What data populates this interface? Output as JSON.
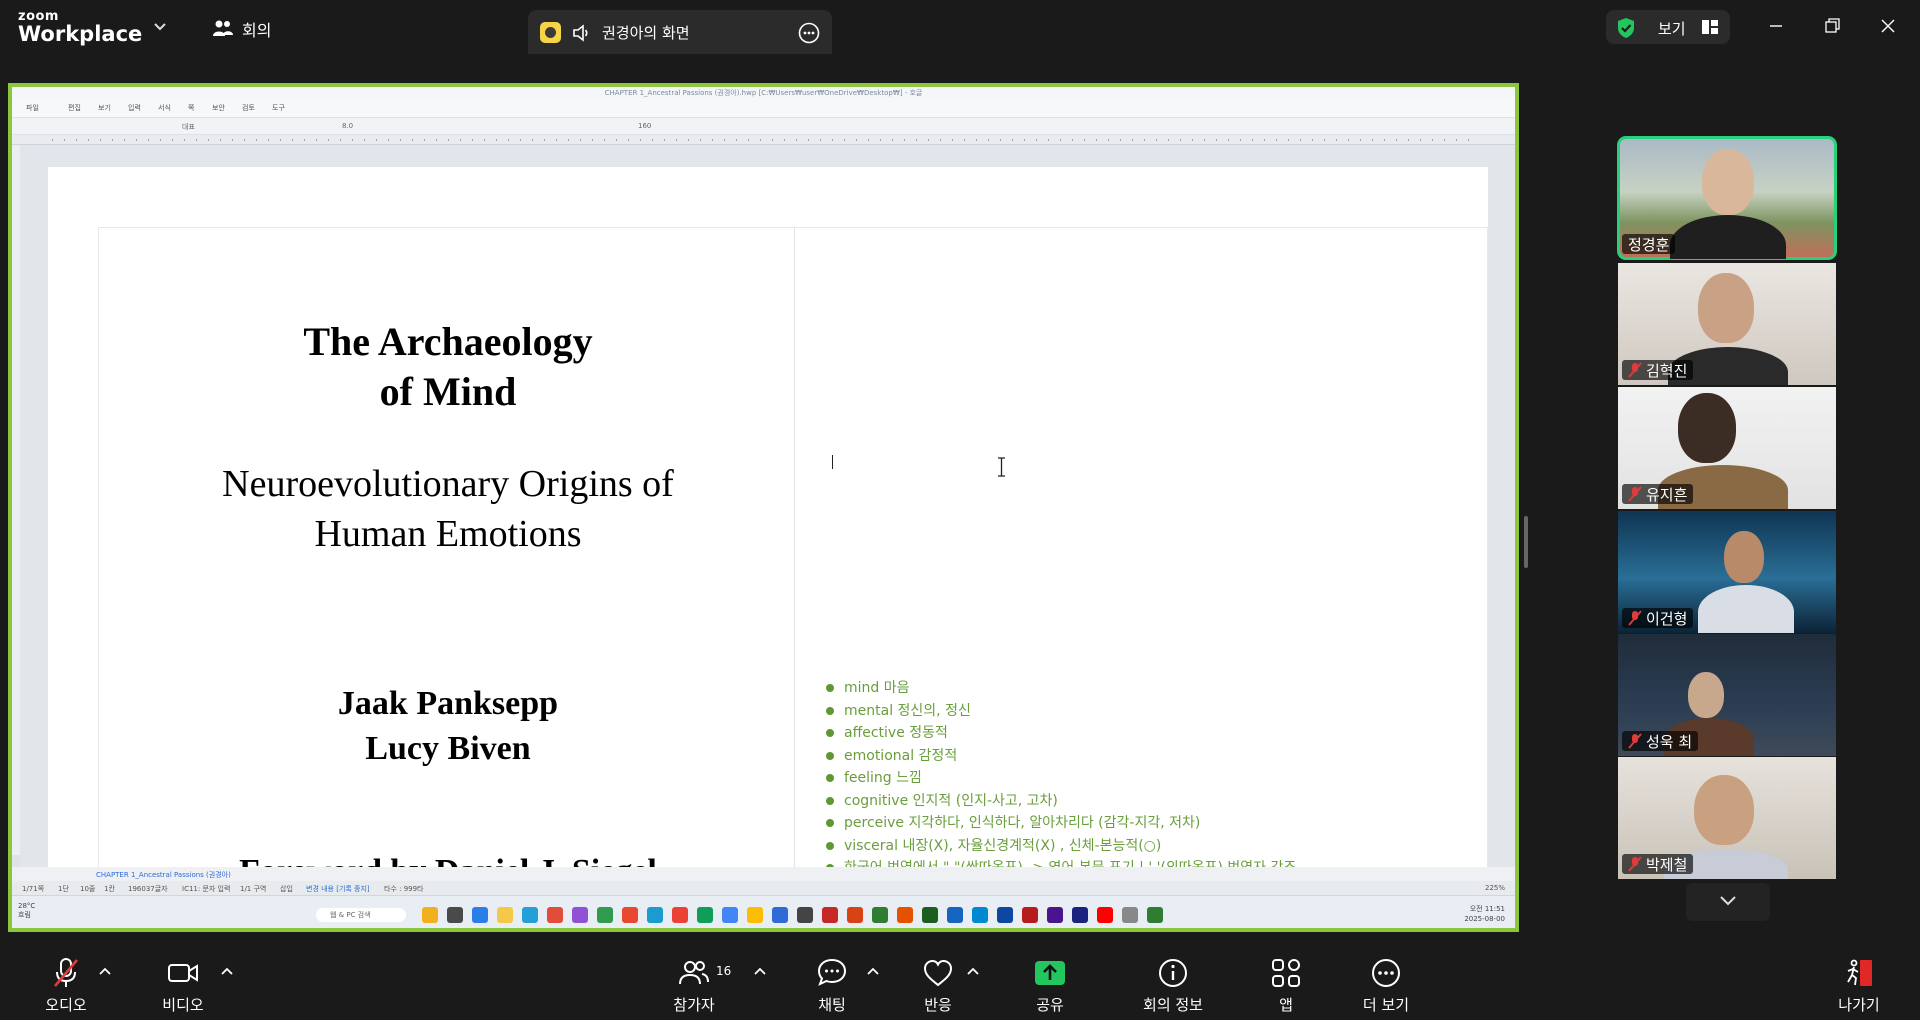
{
  "app": {
    "logo_line1": "zoom",
    "logo_line2": "Workplace",
    "meeting_label": "회의"
  },
  "screen_share": {
    "title": "권경아의 화면",
    "accent": "#8cc63f"
  },
  "view": {
    "label": "보기",
    "shield_color": "#22c55e"
  },
  "hwp": {
    "window_title": "CHAPTER 1_Ancestral Passions (권경아).hwp [C:₩Users₩user₩OneDrive₩Desktop₩] - 호글",
    "menus": [
      "파일",
      "편집",
      "보기",
      "입력",
      "서식",
      "쪽",
      "보안",
      "검토",
      "도구"
    ],
    "font_size": "8.0",
    "style_name": "대표",
    "zoom_ratio": "160",
    "doc_tab": "CHAPTER 1_Ancestral Passions (권경아)",
    "status": [
      "1/71쪽",
      "1단",
      "10줄",
      "1칸",
      "196037글자",
      "IC11: 문자 입력",
      "1/1 구역",
      "삽입",
      "변경 내용 [기록 중지]",
      "타수 : 999타"
    ],
    "zoom_percent": "225%",
    "weather": "28°C",
    "weather_sub": "흐림",
    "search_label": "웹 & PC 검색",
    "clock_time": "오전 11:51",
    "clock_date": "2025-08-00"
  },
  "document": {
    "title_line1": "The Archaeology",
    "title_line2": "of Mind",
    "subtitle_line1": "Neuroevolutionary Origins of",
    "subtitle_line2": "Human Emotions",
    "author1": "Jaak Panksepp",
    "author2": "Lucy Biven",
    "foreword": "Foreword by Daniel J. Siegel",
    "vocab": [
      "mind 마음",
      "mental 정신의, 정신",
      "affective 정동적",
      "emotional 감정적",
      "feeling 느낌",
      "cognitive 인지적 (인지-사고, 고차)",
      "perceive 지각하다, 인식하다, 알아차리다 (감각-지각, 저차)",
      "visceral 내장(X), 자율신경계적(X) , 신체-본능적(○)",
      "한국어 번역에서 \" \"(쌍따옴표) -> 영어 본문 표기 | ' '(외따옴표) 번역자 강조"
    ]
  },
  "participants": [
    {
      "name": "정경훈",
      "muted": false,
      "active": true
    },
    {
      "name": "김혁진",
      "muted": true,
      "active": false
    },
    {
      "name": "유지흔",
      "muted": true,
      "active": false
    },
    {
      "name": "이건형",
      "muted": true,
      "active": false
    },
    {
      "name": "성욱 최",
      "muted": true,
      "active": false
    },
    {
      "name": "박제철",
      "muted": true,
      "active": false
    }
  ],
  "controls": {
    "audio": "오디오",
    "video": "비디오",
    "participants": "참가자",
    "participant_count": "16",
    "chat": "채팅",
    "reactions": "반응",
    "share": "공유",
    "meeting_info": "회의 정보",
    "apps": "앱",
    "more": "더 보기",
    "leave": "나가기",
    "share_color": "#22c55e",
    "leave_color": "#e02828"
  }
}
